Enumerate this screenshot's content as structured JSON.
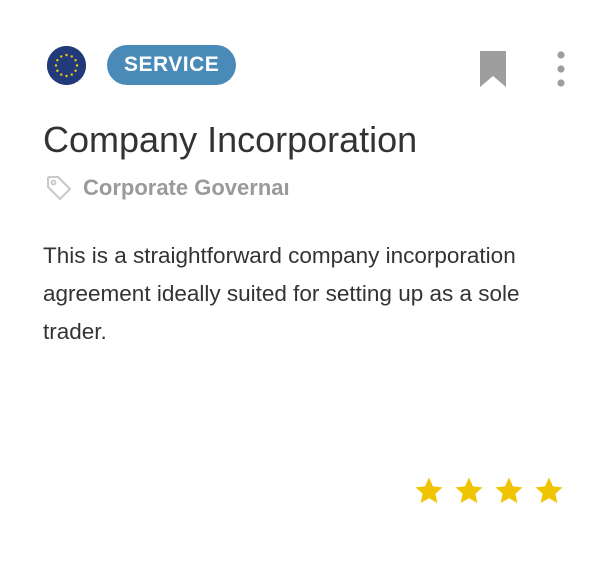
{
  "card": {
    "flag_icon": "eu-flag-icon",
    "badge_label": "SERVICE",
    "title": "Company Incorporation",
    "category": {
      "icon": "tag-icon",
      "label": "Corporate Governaı"
    },
    "description": "This is a straightforward company incorporation agreement ideally suited for setting up as a sole trader.",
    "bookmark_icon": "bookmark-icon",
    "menu_icon": "vertical-dots-icon",
    "rating": {
      "value": 4,
      "max": 4,
      "icon": "star-icon"
    }
  },
  "colors": {
    "badge_background": "#4a8ab8",
    "badge_text": "#ffffff",
    "title_text": "#333333",
    "category_text": "#9a9a9a",
    "icon_gray": "#9e9e9e",
    "star": "#f0c400",
    "flag_blue": "#233a7a",
    "flag_stars": "#f5cc00"
  }
}
